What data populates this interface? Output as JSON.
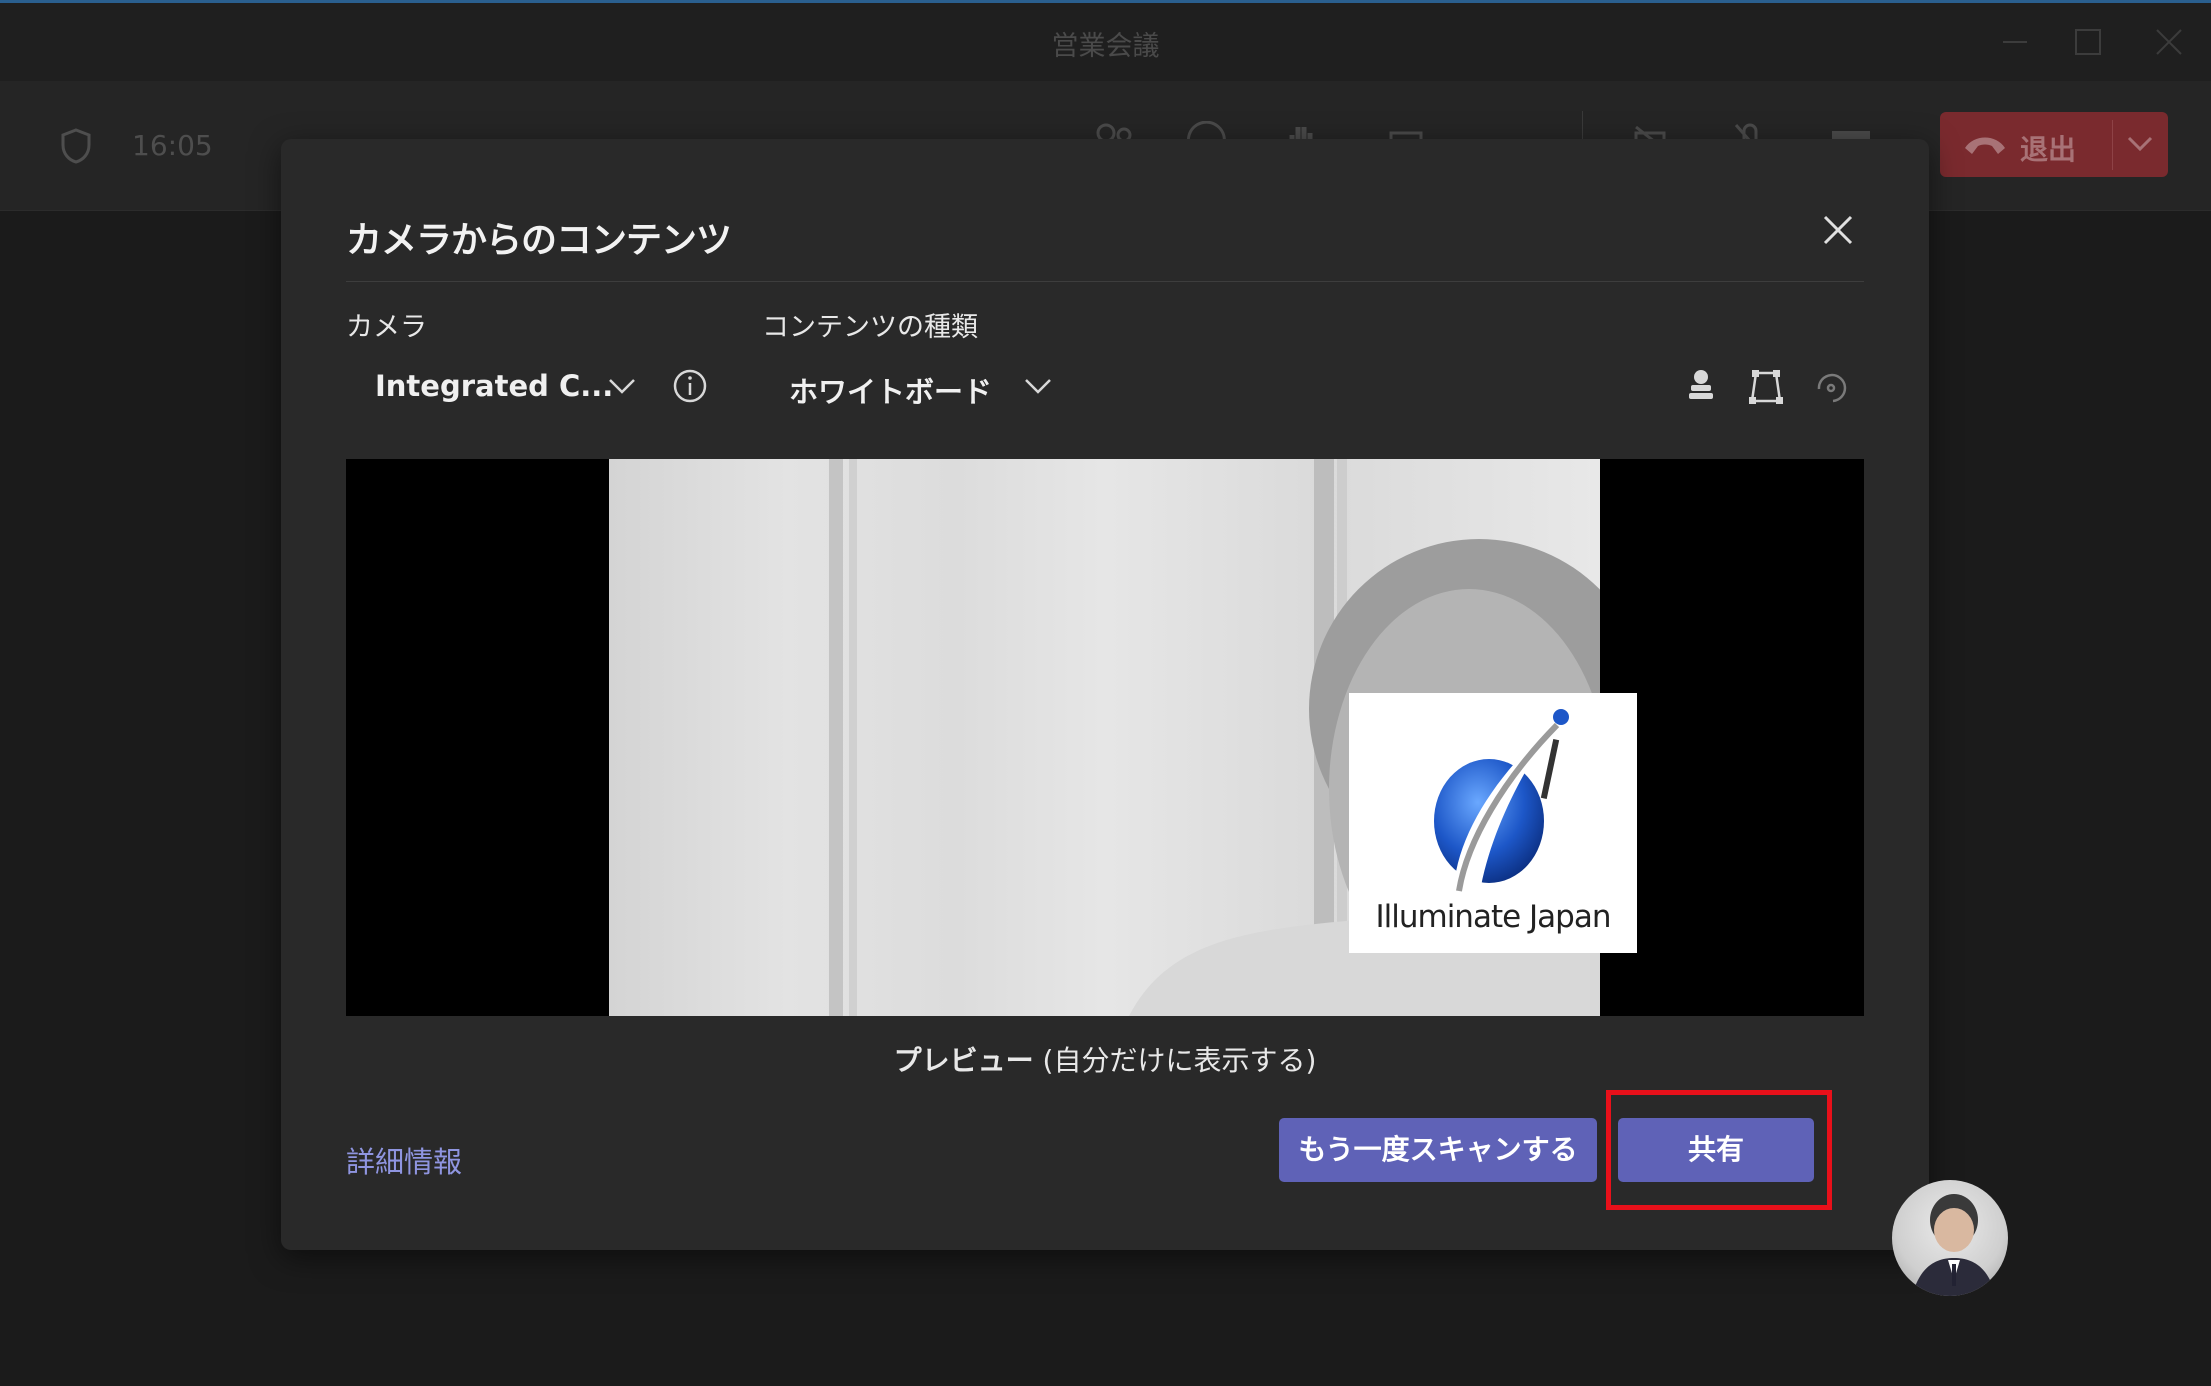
{
  "window": {
    "title": "営業会議"
  },
  "toolbar": {
    "time": "16:05",
    "leave_label": "退出"
  },
  "dialog": {
    "title": "カメラからのコンテンツ",
    "camera_label": "カメラ",
    "camera_value": "Integrated C...",
    "content_type_label": "コンテンツの種類",
    "content_type_value": "ホワイトボード",
    "preview_caption_bold": "プレビュー",
    "preview_caption_rest": " (自分だけに表示する)",
    "logo_text": "Illuminate Japan",
    "details_link": "詳細情報",
    "rescan_button": "もう一度スキャンする",
    "share_button": "共有"
  },
  "colors": {
    "accent_button": "#5f62b7",
    "leave_button": "#7a2a2e",
    "highlight_box": "#e8101a",
    "link": "#8f95e0"
  },
  "icons": [
    "shield-icon",
    "participants-icon",
    "chat-icon",
    "raise-hand-icon",
    "share-tray-icon",
    "camera-off-icon",
    "mic-off-icon",
    "share-icon",
    "phone-icon",
    "chevron-down-icon",
    "close-icon",
    "info-icon",
    "ink-icon",
    "crop-icon",
    "rotate-icon",
    "minimize-icon",
    "maximize-icon"
  ]
}
